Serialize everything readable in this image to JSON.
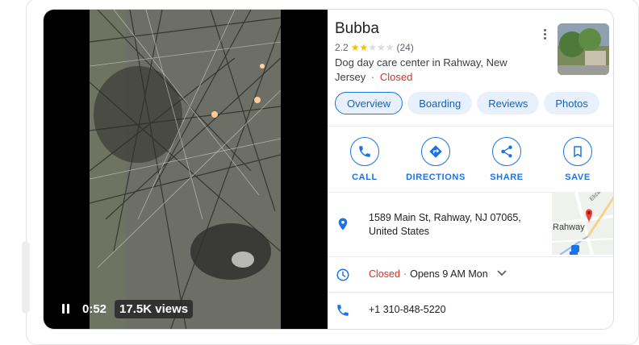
{
  "video": {
    "elapsed": "0:52",
    "views": "17.5K views"
  },
  "place": {
    "name": "Bubba",
    "rating": "2.2",
    "stars_filled": 2,
    "stars_total": 5,
    "review_count": "(24)",
    "category": "Dog day care center in Rahway, New Jersey",
    "separator": "·",
    "status": "Closed"
  },
  "tabs": [
    {
      "label": "Overview",
      "active": true
    },
    {
      "label": "Boarding",
      "active": false
    },
    {
      "label": "Reviews",
      "active": false
    },
    {
      "label": "Photos",
      "active": false
    }
  ],
  "actions": [
    {
      "label": "CALL",
      "icon": "phone-icon"
    },
    {
      "label": "DIRECTIONS",
      "icon": "directions-icon"
    },
    {
      "label": "SHARE",
      "icon": "share-icon"
    },
    {
      "label": "SAVE",
      "icon": "bookmark-icon"
    }
  ],
  "address": {
    "line1": "1589 Main St, Rahway, NJ 07065,",
    "line2": "United States",
    "map_labels": {
      "town": "Rahway",
      "street": "Elizabeth A"
    }
  },
  "hours": {
    "status": "Closed",
    "separator": "·",
    "next": "Opens 9 AM Mon"
  },
  "phone": "+1 310-848-5220",
  "colors": {
    "accent": "#1a73e8",
    "closed": "#d93025",
    "star": "#fbbc04"
  }
}
